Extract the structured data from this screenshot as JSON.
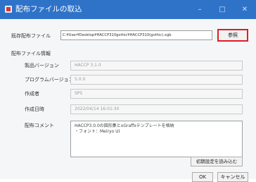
{
  "window": {
    "title": "配布ファイルの取込",
    "minimize_glyph": "–",
    "maximize_glyph": "□",
    "close_glyph": "✕"
  },
  "file_row": {
    "label": "既存配布ファイル",
    "path_value": "C:¥User¥Desktop¥HACCP310gothic¥HACCP310(gothic).xgb",
    "browse_label": "参照"
  },
  "info": {
    "section_title": "配布ファイル情報",
    "rows": [
      {
        "label": "製品バージョン",
        "value": "HACCP 3.1.0"
      },
      {
        "label": "プログラムバージョン",
        "value": "5.0.0"
      },
      {
        "label": "作成者",
        "value": "SPS"
      },
      {
        "label": "作成日時",
        "value": "2022/04/14 16:01:30"
      }
    ],
    "comment_label": "配布コメント",
    "comment_lines": [
      "HACCP3.0.0の図形集とxGraffxテンプレートを格納",
      "・フォント：Meiryo UI"
    ]
  },
  "buttons": {
    "init_label": "初期設定を読み込む",
    "ok_label": "OK",
    "cancel_label": "キャンセル"
  },
  "colors": {
    "titlebar": "#2f73c9",
    "highlight": "#e21b25"
  },
  "icons": {
    "app": "app-icon"
  }
}
